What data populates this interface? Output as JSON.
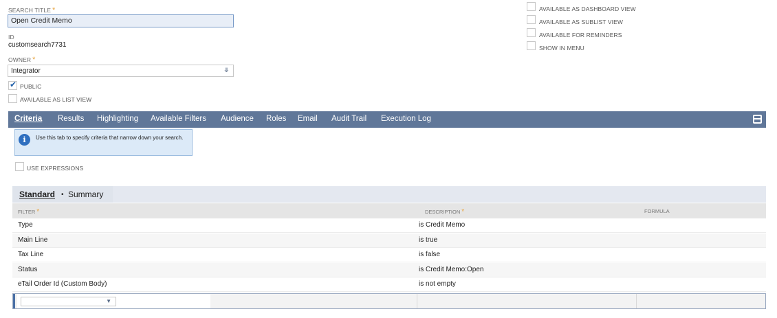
{
  "form": {
    "search_title_label": "SEARCH TITLE",
    "search_title_value": "Open Credit Memo",
    "id_label": "ID",
    "id_value": "customsearch7731",
    "owner_label": "OWNER",
    "owner_value": "Integrator",
    "required_mark": "*",
    "public_label": "PUBLIC",
    "public_checked": true,
    "list_view_label": "AVAILABLE AS LIST VIEW",
    "list_view_checked": false
  },
  "right_options": [
    {
      "label": "AVAILABLE AS DASHBOARD VIEW",
      "checked": false
    },
    {
      "label": "AVAILABLE AS SUBLIST VIEW",
      "checked": false
    },
    {
      "label": "AVAILABLE FOR REMINDERS",
      "checked": false
    },
    {
      "label": "SHOW IN MENU",
      "checked": false
    }
  ],
  "tabs": [
    {
      "label": "Criteria",
      "active": true
    },
    {
      "label": "Results"
    },
    {
      "label": "Highlighting"
    },
    {
      "label": "Available Filters"
    },
    {
      "label": "Audience"
    },
    {
      "label": "Roles"
    },
    {
      "label": "Email"
    },
    {
      "label": "Audit Trail"
    },
    {
      "label": "Execution Log"
    }
  ],
  "info": {
    "icon": "info-icon",
    "text": "Use this tab to specify criteria that narrow down your search."
  },
  "use_expressions_label": "USE EXPRESSIONS",
  "subtabs": {
    "standard": "Standard",
    "bullet": "•",
    "summary": "Summary"
  },
  "grid": {
    "columns": {
      "filter": "FILTER",
      "description": "DESCRIPTION",
      "formula": "FORMULA"
    },
    "rows": [
      {
        "filter": "Type",
        "description": "is Credit Memo"
      },
      {
        "filter": "Main Line",
        "description": "is true"
      },
      {
        "filter": "Tax Line",
        "description": "is false"
      },
      {
        "filter": "Status",
        "description": "is Credit Memo:Open"
      },
      {
        "filter": "eTail Order Id (Custom Body)",
        "description": "is not empty"
      }
    ]
  },
  "colors": {
    "tabbar": "#607799",
    "required": "#e8a33d",
    "info_bg": "#dceaf8"
  }
}
